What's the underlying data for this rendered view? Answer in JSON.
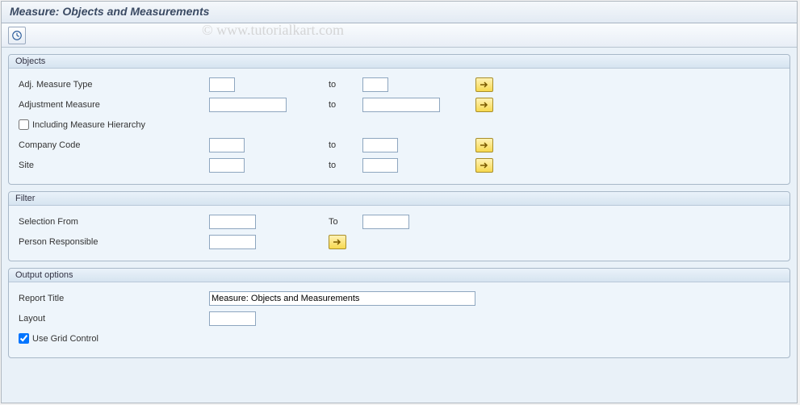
{
  "title": "Measure: Objects and Measurements",
  "watermark": "© www.tutorialkart.com",
  "groups": {
    "objects": {
      "title": "Objects",
      "adj_measure_type": {
        "label": "Adj. Measure Type",
        "from": "",
        "sep": "to",
        "to": ""
      },
      "adjustment_measure": {
        "label": "Adjustment Measure",
        "from": "",
        "sep": "to",
        "to": ""
      },
      "including_hierarchy": {
        "label": "Including Measure Hierarchy",
        "checked": false
      },
      "company_code": {
        "label": "Company Code",
        "from": "",
        "sep": "to",
        "to": ""
      },
      "site": {
        "label": "Site",
        "from": "",
        "sep": "to",
        "to": ""
      }
    },
    "filter": {
      "title": "Filter",
      "selection_from": {
        "label": "Selection From",
        "from": "",
        "sep": "To",
        "to": ""
      },
      "person_responsible": {
        "label": "Person Responsible",
        "from": ""
      }
    },
    "output": {
      "title": "Output options",
      "report_title": {
        "label": "Report Title",
        "value": "Measure: Objects and Measurements"
      },
      "layout": {
        "label": "Layout",
        "value": ""
      },
      "use_grid": {
        "label": "Use Grid Control",
        "checked": true
      }
    }
  }
}
